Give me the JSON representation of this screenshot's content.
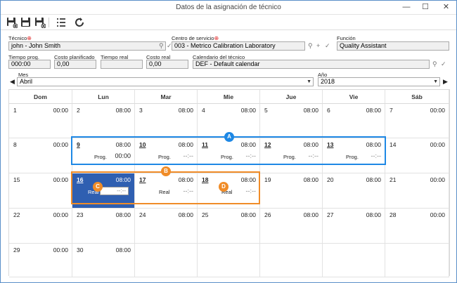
{
  "window": {
    "title": "Datos de la asignación de técnico",
    "minimize": "—",
    "maximize": "☐",
    "close": "✕"
  },
  "fields": {
    "tecnico_label": "Técnico",
    "tecnico_value": "john - John Smith",
    "centro_label": "Centro de servicio",
    "centro_value": "003 - Metrico Calibration Laboratory",
    "funcion_label": "Función",
    "funcion_value": "Quality Assistant",
    "tiempo_prog_label": "Tiempo prog.",
    "tiempo_prog_value": "000:00",
    "costo_plan_label": "Costo planificado",
    "costo_plan_value": "0,00",
    "tiempo_real_label": "Tiempo real",
    "tiempo_real_value": "",
    "costo_real_label": "Costo real",
    "costo_real_value": "0,00",
    "calendario_label": "Calendario del técnico",
    "calendario_value": "DEF - Default calendar",
    "mes_label": "Mes",
    "mes_value": "Abril",
    "ano_label": "Año",
    "ano_value": "2018"
  },
  "calendar": {
    "weekdays": [
      "Dom",
      "Lun",
      "Mar",
      "Mie",
      "Jue",
      "Vie",
      "Sáb"
    ],
    "weeks": [
      [
        {
          "d": "1",
          "t": "00:00"
        },
        {
          "d": "2",
          "t": "08:00"
        },
        {
          "d": "3",
          "t": "08:00"
        },
        {
          "d": "4",
          "t": "08:00"
        },
        {
          "d": "5",
          "t": "08:00"
        },
        {
          "d": "6",
          "t": "08:00"
        },
        {
          "d": "7",
          "t": "00:00"
        }
      ],
      [
        {
          "d": "8",
          "t": "00:00"
        },
        {
          "d": "9",
          "t": "08:00",
          "u": true,
          "sub": "Prog.",
          "v": "00:00",
          "dark": true
        },
        {
          "d": "10",
          "t": "08:00",
          "u": true,
          "sub": "Prog.",
          "v": "--:--"
        },
        {
          "d": "11",
          "t": "08:00",
          "u": true,
          "sub": "Prog.",
          "v": "--:--"
        },
        {
          "d": "12",
          "t": "08:00",
          "u": true,
          "sub": "Prog.",
          "v": "--:--"
        },
        {
          "d": "13",
          "t": "08:00",
          "u": true,
          "sub": "Prog.",
          "v": "--:--"
        },
        {
          "d": "14",
          "t": "00:00"
        }
      ],
      [
        {
          "d": "15",
          "t": "00:00"
        },
        {
          "d": "16",
          "t": "08:00",
          "u": true,
          "sub": "Real",
          "v": "--:--",
          "selected": true
        },
        {
          "d": "17",
          "t": "08:00",
          "u": true,
          "sub": "Real",
          "v": "--:--"
        },
        {
          "d": "18",
          "t": "08:00",
          "u": true,
          "sub": "Real",
          "v": "--:--"
        },
        {
          "d": "19",
          "t": "08:00"
        },
        {
          "d": "20",
          "t": "08:00"
        },
        {
          "d": "21",
          "t": "00:00"
        }
      ],
      [
        {
          "d": "22",
          "t": "00:00"
        },
        {
          "d": "23",
          "t": "08:00"
        },
        {
          "d": "24",
          "t": "08:00"
        },
        {
          "d": "25",
          "t": "08:00"
        },
        {
          "d": "26",
          "t": "08:00"
        },
        {
          "d": "27",
          "t": "08:00"
        },
        {
          "d": "28",
          "t": "00:00"
        }
      ],
      [
        {
          "d": "29",
          "t": "00:00"
        },
        {
          "d": "30",
          "t": "08:00"
        },
        {},
        {},
        {},
        {},
        {}
      ]
    ]
  },
  "badges": {
    "a": "A",
    "b": "B",
    "c": "C",
    "d": "D"
  },
  "colors": {
    "highlight_blue": "#1e88e5",
    "highlight_orange": "#f08c28",
    "selected_cell": "#2f5fb1"
  }
}
